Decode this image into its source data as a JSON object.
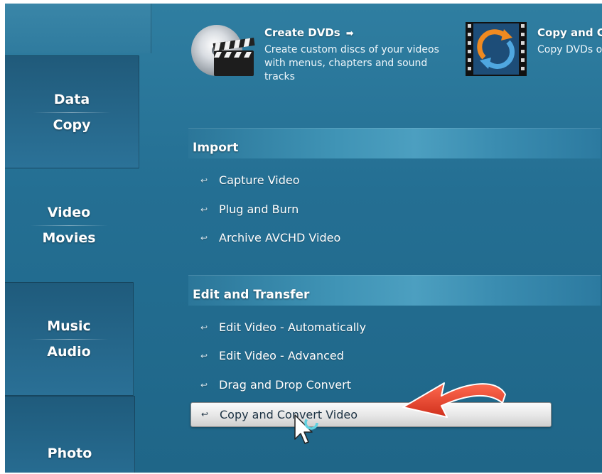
{
  "sidebar": {
    "data_copy": {
      "line1": "Data",
      "line2": "Copy"
    },
    "video_movies": {
      "line1": "Video",
      "line2": "Movies"
    },
    "music_audio": {
      "line1": "Music",
      "line2": "Audio"
    },
    "photo": {
      "label": "Photo"
    }
  },
  "features": {
    "create_dvds": {
      "title": "Create DVDs",
      "description": "Create custom discs of your videos\nwith menus, chapters and sound\ntracks",
      "icon": "dvd-clapperboard-icon"
    },
    "copy_convert": {
      "title": "Copy and Co",
      "description": "Copy DVDs o",
      "icon": "copy-convert-icon"
    }
  },
  "sections": {
    "import": {
      "title": "Import",
      "items": [
        {
          "label": "Capture Video"
        },
        {
          "label": "Plug and Burn"
        },
        {
          "label": "Archive AVCHD Video"
        }
      ]
    },
    "edit_transfer": {
      "title": "Edit and Transfer",
      "items": [
        {
          "label": "Edit Video - Automatically"
        },
        {
          "label": "Edit Video - Advanced"
        },
        {
          "label": "Drag and Drop Convert"
        },
        {
          "label": "Copy and Convert Video"
        }
      ]
    }
  },
  "colors": {
    "background": "#246f93",
    "annotation_arrow": "#e8402a",
    "selected_item_bg": "#e6e6e6"
  }
}
